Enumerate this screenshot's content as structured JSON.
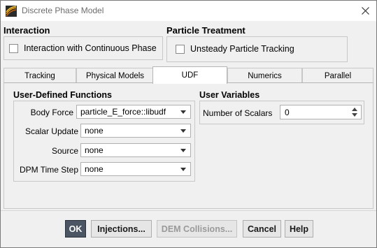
{
  "window": {
    "title": "Discrete Phase Model",
    "close_icon": "close-icon",
    "app_icon": "fluent-app-icon"
  },
  "interaction": {
    "title": "Interaction",
    "checkbox_label": "Interaction with Continuous Phase",
    "checked": false
  },
  "particle_treatment": {
    "title": "Particle Treatment",
    "checkbox_label": "Unsteady Particle Tracking",
    "checked": false
  },
  "tabs": [
    {
      "label": "Tracking",
      "active": false
    },
    {
      "label": "Physical Models",
      "active": false
    },
    {
      "label": "UDF",
      "active": true
    },
    {
      "label": "Numerics",
      "active": false
    },
    {
      "label": "Parallel",
      "active": false
    }
  ],
  "udf": {
    "title": "User-Defined Functions",
    "rows": [
      {
        "label": "Body Force",
        "value": "particle_E_force::libudf"
      },
      {
        "label": "Scalar Update",
        "value": "none"
      },
      {
        "label": "Source",
        "value": "none"
      },
      {
        "label": "DPM Time Step",
        "value": "none"
      }
    ]
  },
  "user_variables": {
    "title": "User Variables",
    "label": "Number of Scalars",
    "value": "0"
  },
  "buttons": {
    "ok": "OK",
    "injections": "Injections...",
    "dem_collisions": "DEM Collisions...",
    "cancel": "Cancel",
    "help": "Help"
  },
  "colors": {
    "primary_button": "#4b5563",
    "window_bg": "#f0f0f0"
  }
}
